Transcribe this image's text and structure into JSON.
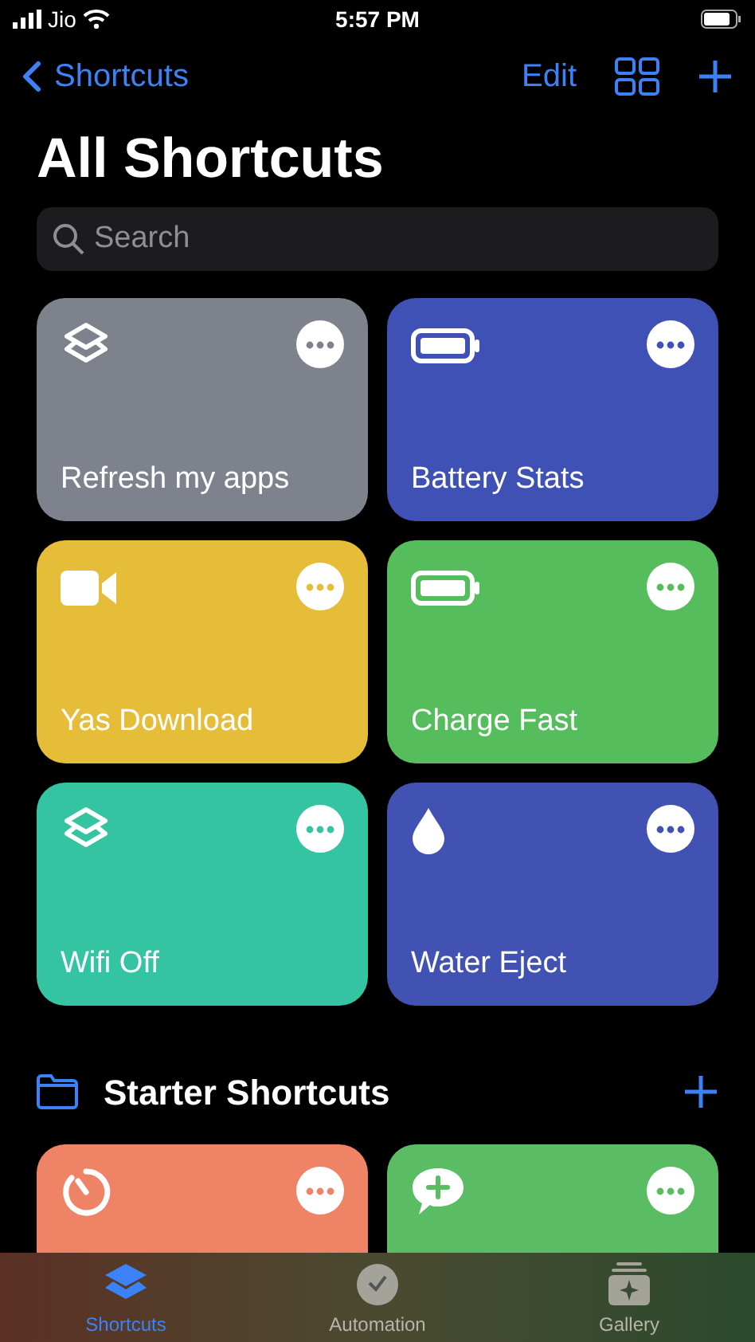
{
  "status_bar": {
    "carrier": "Jio",
    "time": "5:57 PM"
  },
  "nav": {
    "back": "Shortcuts",
    "edit": "Edit"
  },
  "title": "All Shortcuts",
  "search": {
    "placeholder": "Search"
  },
  "shortcuts": [
    {
      "title": "Refresh my apps",
      "kind": "layers",
      "color": "#7d828c"
    },
    {
      "title": "Battery Stats",
      "kind": "battery",
      "color": "#3f51b5"
    },
    {
      "title": "Yas Download",
      "kind": "video",
      "color": "#e6bd38"
    },
    {
      "title": "Charge Fast",
      "kind": "battery",
      "color": "#56bd5c"
    },
    {
      "title": "Wifi Off",
      "kind": "layers",
      "color": "#35c4a2"
    },
    {
      "title": "Water Eject",
      "kind": "drop",
      "color": "#4152b3"
    }
  ],
  "starter": {
    "title": "Starter Shortcuts",
    "shortcuts": [
      {
        "kind": "timer",
        "color": "#ee8366"
      },
      {
        "kind": "message",
        "color": "#5bbd63"
      }
    ]
  },
  "tabs": [
    {
      "label": "Shortcuts",
      "kind": "layers",
      "selected": true
    },
    {
      "label": "Automation",
      "kind": "clock",
      "selected": false
    },
    {
      "label": "Gallery",
      "kind": "gallery",
      "selected": false
    }
  ]
}
